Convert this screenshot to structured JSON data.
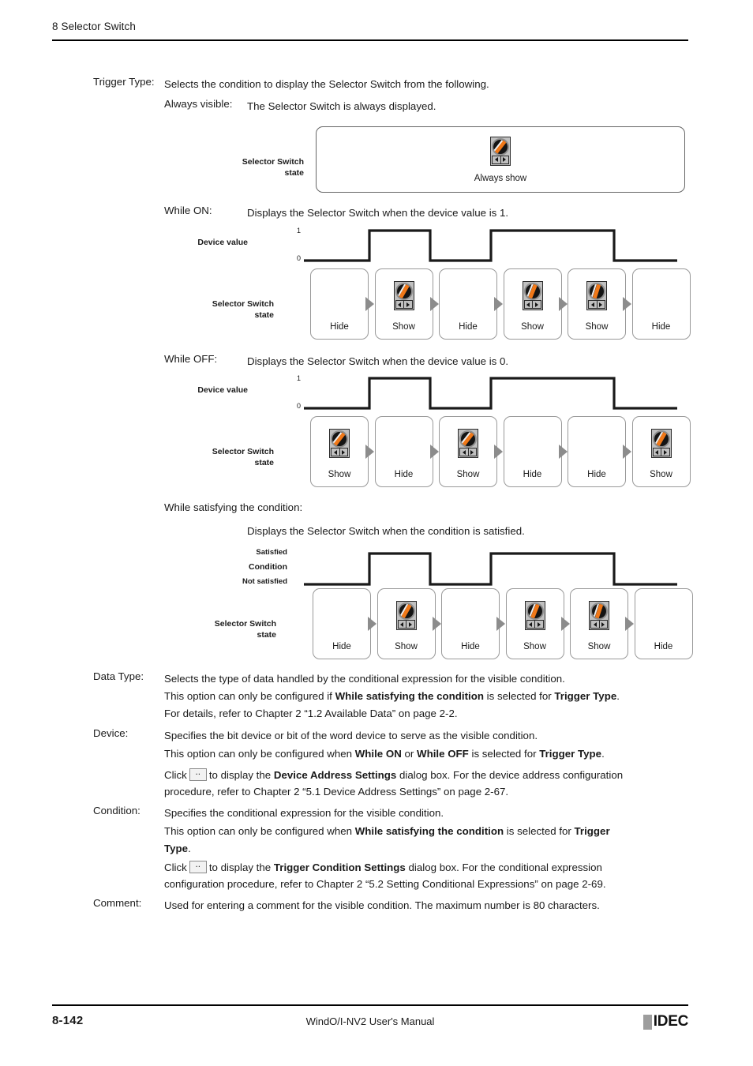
{
  "header": {
    "chapter": "8 Selector Switch"
  },
  "footer": {
    "page_number": "8-142",
    "manual_title": "WindO/I-NV2 User's Manual",
    "logo_text": "IDEC"
  },
  "trigger_type": {
    "term": "Trigger Type:",
    "description": "Selects the condition to display the Selector Switch from the following."
  },
  "always_visible": {
    "term": "Always visible:",
    "description": "The Selector Switch is always displayed.",
    "state_label_line1": "Selector Switch",
    "state_label_line2": "state",
    "caption": "Always show"
  },
  "while_on": {
    "term": "While ON:",
    "description": "Displays the Selector Switch when the device value is 1.",
    "axis_label": "Device value",
    "tick_high": "1",
    "tick_low": "0",
    "state_label_line1": "Selector Switch",
    "state_label_line2": "state",
    "cells": [
      "Hide",
      "Show",
      "Hide",
      "Show",
      "Show",
      "Hide"
    ],
    "shown": [
      false,
      true,
      false,
      true,
      true,
      false
    ]
  },
  "while_off": {
    "term": "While OFF:",
    "description": "Displays the Selector Switch when the device value is 0.",
    "axis_label": "Device value",
    "tick_high": "1",
    "tick_low": "0",
    "state_label_line1": "Selector Switch",
    "state_label_line2": "state",
    "cells": [
      "Show",
      "Hide",
      "Show",
      "Hide",
      "Hide",
      "Show"
    ],
    "shown": [
      true,
      false,
      true,
      false,
      false,
      true
    ]
  },
  "while_condition": {
    "term": "While satisfying the condition:",
    "description": "Displays the Selector Switch when the condition is satisfied.",
    "axis_label": "Condition",
    "tick_high": "Satisfied",
    "tick_low": "Not satisfied",
    "state_label_line1": "Selector Switch",
    "state_label_line2": "state",
    "cells": [
      "Hide",
      "Show",
      "Hide",
      "Show",
      "Show",
      "Hide"
    ],
    "shown": [
      false,
      true,
      false,
      true,
      true,
      false
    ]
  },
  "data_type": {
    "term": "Data Type:",
    "line1": "Selects the type of data handled by the conditional expression for the visible condition.",
    "line2_a": "This option can only be configured if ",
    "line2_b": "While satisfying the condition",
    "line2_c": " is selected for ",
    "line2_d": "Trigger Type",
    "line2_e": ".",
    "line3": "For details, refer to Chapter 2 “1.2 Available Data” on page 2-2."
  },
  "device": {
    "term": "Device:",
    "line1": "Specifies the bit device or bit of the word device to serve as the visible condition.",
    "line2_a": "This option can only be configured when ",
    "line2_b": "While ON",
    "line2_c": " or ",
    "line2_d": "While OFF",
    "line2_e": " is selected for ",
    "line2_f": "Trigger Type",
    "line2_g": ".",
    "line3_a": "Click",
    "line3_b": "to display the ",
    "line3_c": "Device Address Settings",
    "line3_d": " dialog box. For the device address configuration",
    "line4": "procedure, refer to Chapter 2 “5.1 Device Address Settings” on page 2-67."
  },
  "condition": {
    "term": "Condition:",
    "line1": "Specifies the conditional expression for the visible condition.",
    "line2_a": "This option can only be configured when ",
    "line2_b": "While satisfying the condition",
    "line2_c": " is selected for ",
    "line2_d": "Trigger",
    "line3_a": "Type",
    "line3_b": ".",
    "line4_a": "Click",
    "line4_b": "to display the ",
    "line4_c": "Trigger Condition Settings",
    "line4_d": " dialog box. For the conditional expression",
    "line5": "configuration procedure, refer to Chapter 2 “5.2 Setting Conditional Expressions” on page 2-69."
  },
  "comment": {
    "term": "Comment:",
    "line1": "Used for entering a comment for the visible condition. The maximum number is 80 characters."
  },
  "colors": {
    "knob_orange": "#f07818",
    "arrow_gray": "#8c8c8c",
    "logo_gray": "#9d9d9d"
  },
  "chart_data": [
    {
      "type": "line",
      "title": "While ON",
      "ylabel": "Device value",
      "yticks": [
        "0",
        "1"
      ],
      "waveform": [
        {
          "from": 0,
          "to": 0.2,
          "value": 0
        },
        {
          "from": 0.2,
          "to": 0.37,
          "value": 1
        },
        {
          "from": 0.37,
          "to": 0.53,
          "value": 0
        },
        {
          "from": 0.53,
          "to": 0.87,
          "value": 1
        },
        {
          "from": 0.87,
          "to": 1.0,
          "value": 0
        }
      ],
      "states": [
        "Hide",
        "Show",
        "Hide",
        "Show",
        "Show",
        "Hide"
      ]
    },
    {
      "type": "line",
      "title": "While OFF",
      "ylabel": "Device value",
      "yticks": [
        "0",
        "1"
      ],
      "waveform": [
        {
          "from": 0,
          "to": 0.2,
          "value": 0
        },
        {
          "from": 0.2,
          "to": 0.37,
          "value": 1
        },
        {
          "from": 0.37,
          "to": 0.53,
          "value": 0
        },
        {
          "from": 0.53,
          "to": 0.87,
          "value": 1
        },
        {
          "from": 0.87,
          "to": 1.0,
          "value": 0
        }
      ],
      "states": [
        "Show",
        "Hide",
        "Show",
        "Hide",
        "Hide",
        "Show"
      ]
    },
    {
      "type": "line",
      "title": "While satisfying the condition",
      "ylabel": "Condition",
      "yticks": [
        "Not satisfied",
        "Satisfied"
      ],
      "waveform": [
        {
          "from": 0,
          "to": 0.2,
          "value": 0
        },
        {
          "from": 0.2,
          "to": 0.37,
          "value": 1
        },
        {
          "from": 0.37,
          "to": 0.53,
          "value": 0
        },
        {
          "from": 0.53,
          "to": 0.87,
          "value": 1
        },
        {
          "from": 0.87,
          "to": 1.0,
          "value": 0
        }
      ],
      "states": [
        "Hide",
        "Show",
        "Hide",
        "Show",
        "Show",
        "Hide"
      ]
    }
  ]
}
